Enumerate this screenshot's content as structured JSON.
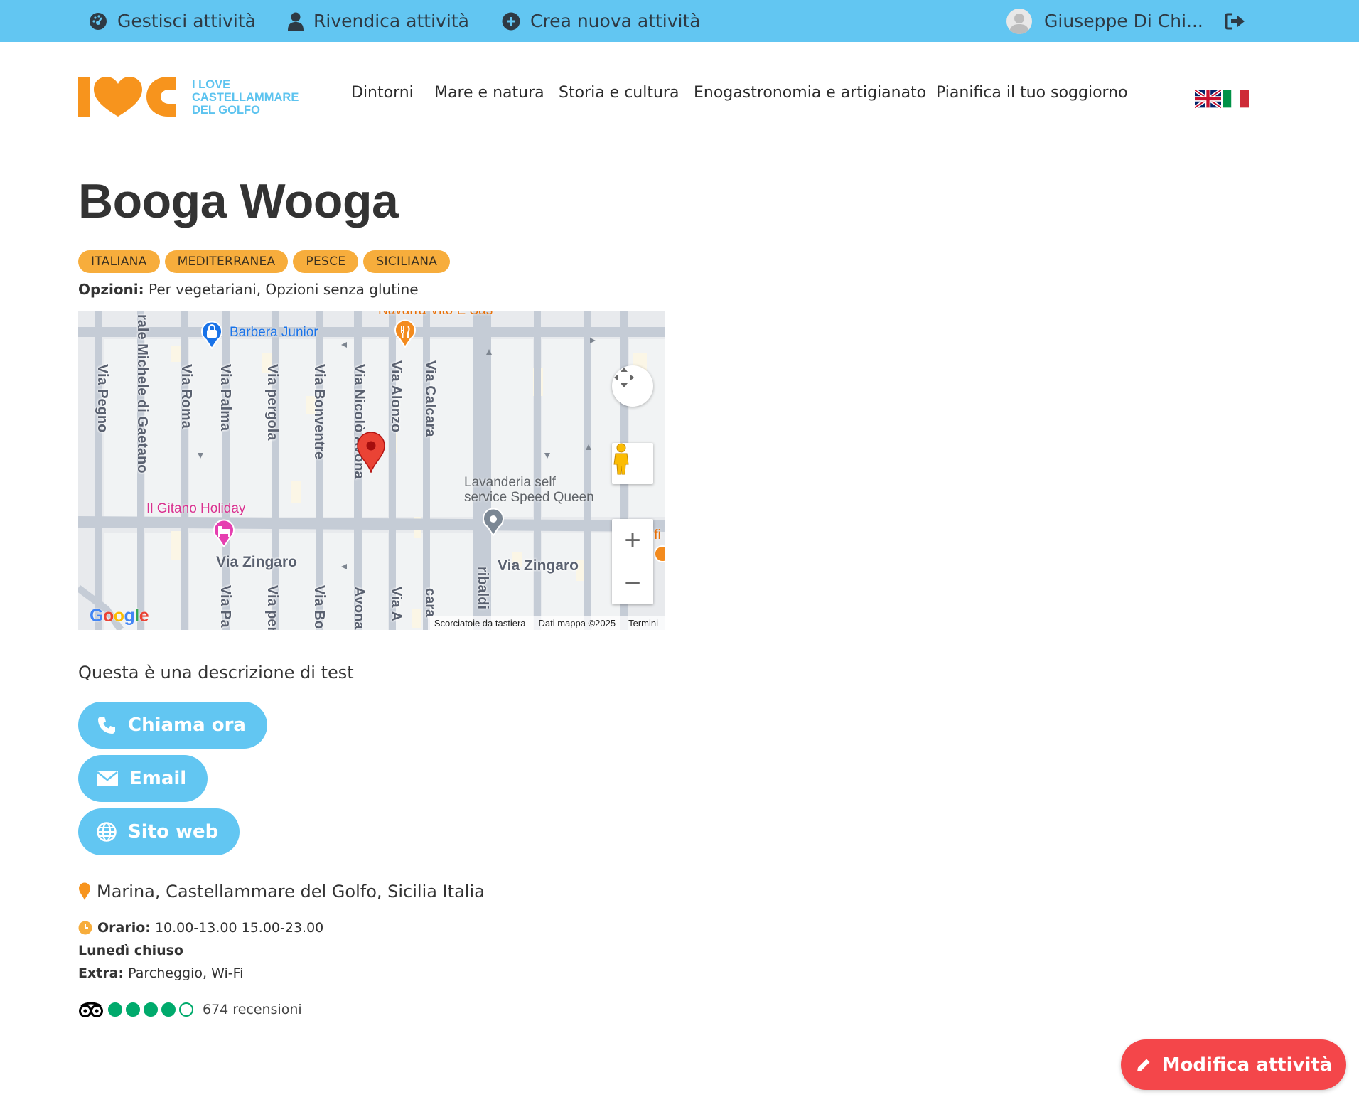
{
  "topbar": {
    "manage": "Gestisci attività",
    "claim": "Rivendica attività",
    "create": "Crea nuova attività",
    "user": "Giuseppe Di Chi..."
  },
  "logo": {
    "line1": "I LOVE",
    "line2": "CASTELLAMMARE",
    "line3": "DEL GOLFO"
  },
  "nav": [
    "Dintorni",
    "Mare e natura",
    "Storia e cultura",
    "Enogastronomia e artigianato",
    "Pianifica il tuo soggiorno"
  ],
  "business": {
    "name": "Booga Wooga",
    "tags": [
      "ITALIANA",
      "MEDITERRANEA",
      "PESCE",
      "SICILIANA"
    ],
    "options_label": "Opzioni:",
    "options_value": "Per vegetariani, Opzioni senza glutine",
    "description": "Questa è una descrizione di test",
    "address": "Marina, Castellammare del Golfo, Sicilia Italia",
    "hours_label": "Orario:",
    "hours_value": "10.00-13.00 15.00-23.00",
    "closed": "Lunedì chiuso",
    "extra_label": "Extra:",
    "extra_value": "Parcheggio, Wi-Fi",
    "rating_filled": 4,
    "rating_total": 5,
    "reviews": "674 recensioni"
  },
  "map": {
    "streets_v": [
      "Via Pegno",
      "rale Michele di Gaetano",
      "Via Roma",
      "Via Palma",
      "Via pergola",
      "Via Bonventre",
      "Via Nicolò Avona",
      "Via Alonzo",
      "Via Calcara"
    ],
    "streets_bottom": [
      "Via Pa",
      "Via per",
      "Via Bo",
      "Avona",
      "Via A",
      "cara",
      "ribaldi"
    ],
    "street_h1": "Via Zingaro",
    "street_h2": "Via Zingaro",
    "poi_barbera": "Barbera Junior",
    "poi_gitano": "Il Gitano Holiday",
    "poi_lavanderia_1": "Lavanderia self",
    "poi_lavanderia_2": "service Speed Queen",
    "poi_top": "Navarra Vito E Sas",
    "poi_right": "ifi",
    "google": "Google",
    "shortcuts": "Scorciatoie da tastiera",
    "mapdata": "Dati mappa ©2025",
    "terms": "Termini",
    "zoom_in": "+",
    "zoom_out": "−"
  },
  "buttons": {
    "call": "Chiama ora",
    "email": "Email",
    "website": "Sito web"
  },
  "edit_button": "Modifica attività",
  "colors": {
    "topbar": "#62c6f2",
    "accent_orange": "#f7941d",
    "tag": "#f7ad3c",
    "button": "#62c6f2",
    "edit": "#f4464a",
    "rating": "#00aa6c"
  }
}
